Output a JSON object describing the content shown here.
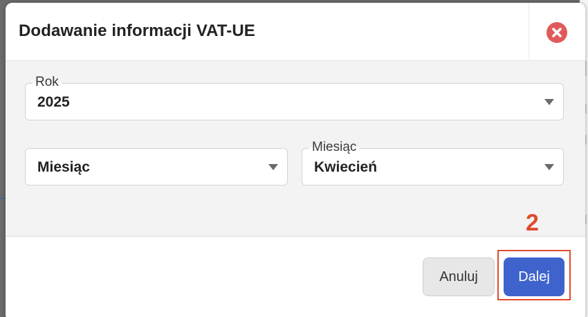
{
  "dialog": {
    "title": "Dodawanie informacji VAT-UE",
    "close_icon": "close-circle-icon"
  },
  "fields": {
    "year": {
      "label": "Rok",
      "value": "2025"
    },
    "period_type": {
      "value": "Miesiąc"
    },
    "month": {
      "label": "Miesiąc",
      "value": "Kwiecień"
    }
  },
  "footer": {
    "cancel_label": "Anuluj",
    "next_label": "Dalej"
  },
  "annotation": {
    "step_number": "2",
    "color": "#e04a2c"
  },
  "colors": {
    "primary": "#3e63cc",
    "close": "#e05a5a"
  }
}
